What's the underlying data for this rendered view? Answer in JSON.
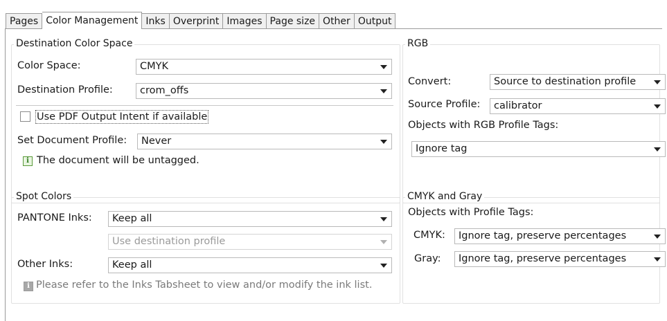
{
  "tabs": [
    "Pages",
    "Color Management",
    "Inks",
    "Overprint",
    "Images",
    "Page size",
    "Other",
    "Output"
  ],
  "destination": {
    "title": "Destination Color Space",
    "color_space_label": "Color Space:",
    "color_space_value": "CMYK",
    "profile_label": "Destination Profile:",
    "profile_value": "crom_offs",
    "output_intent_label": "Use PDF Output Intent if available",
    "set_doc_profile_label": "Set Document Profile:",
    "set_doc_profile_value": "Never",
    "info_text": "The document will be untagged."
  },
  "rgb": {
    "title": "RGB",
    "convert_label": "Convert:",
    "convert_value": "Source to destination profile",
    "source_label": "Source Profile:",
    "source_value": "calibrator",
    "tags_label": "Objects with RGB Profile Tags:",
    "tags_value": "Ignore tag"
  },
  "spot": {
    "title": "Spot Colors",
    "pantone_label": "PANTONE Inks:",
    "pantone_value": "Keep all",
    "pantone_sub_value": "Use destination profile",
    "other_label": "Other Inks:",
    "other_value": "Keep all",
    "info_text": "Please refer to the Inks Tabsheet to view and/or modify the ink list."
  },
  "cmyk_gray": {
    "title": "CMYK and Gray",
    "tags_label": "Objects with Profile Tags:",
    "cmyk_label": "CMYK:",
    "cmyk_value": "Ignore tag, preserve percentages",
    "gray_label": "Gray:",
    "gray_value": "Ignore tag, preserve percentages"
  },
  "icons": {
    "info": "info-icon",
    "dropdown": "chevron-down-icon"
  }
}
